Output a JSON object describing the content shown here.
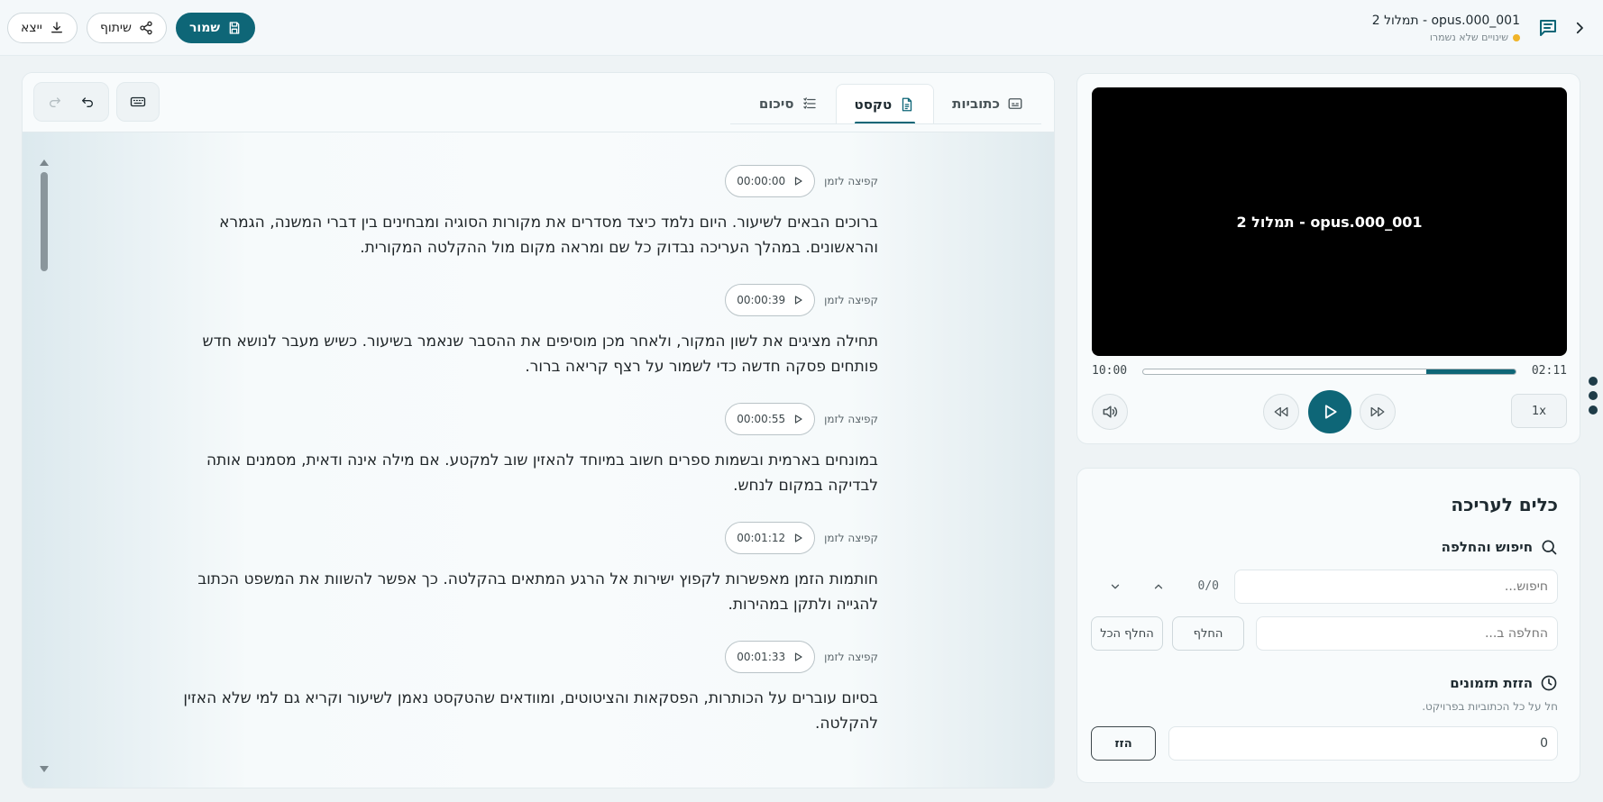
{
  "header": {
    "doc_title": "opus.000_001 - תמלול 2",
    "status": "שינויים שלא נשמרו",
    "save_label": "שמור",
    "share_label": "שיתוף",
    "export_label": "ייצא"
  },
  "editor": {
    "tabs": [
      {
        "label": "כתוביות",
        "icon": "subtitles-icon"
      },
      {
        "label": "טקסט",
        "icon": "document-icon"
      },
      {
        "label": "סיכום",
        "icon": "list-icon"
      }
    ],
    "jump_label": "קפיצה לזמן",
    "paragraphs": [
      {
        "time": "00:00:00",
        "text": "ברוכים הבאים לשיעור. היום נלמד כיצד מסדרים את מקורות הסוגיה ומבחינים בין דברי המשנה, הגמרא והראשונים. במהלך העריכה נבדוק כל שם ומראה מקום מול ההקלטה המקורית."
      },
      {
        "time": "00:00:39",
        "text": "תחילה מציגים את לשון המקור, ולאחר מכן מוסיפים את ההסבר שנאמר בשיעור. כשיש מעבר לנושא חדש פותחים פסקה חדשה כדי לשמור על רצף קריאה ברור."
      },
      {
        "time": "00:00:55",
        "text": "במונחים בארמית ובשמות ספרים חשוב במיוחד להאזין שוב למקטע. אם מילה אינה ודאית, מסמנים אותה לבדיקה במקום לנחש."
      },
      {
        "time": "00:01:12",
        "text": "חותמות הזמן מאפשרות לקפוץ ישירות אל הרגע המתאים בהקלטה. כך אפשר להשוות את המשפט הכתוב להגייה ולתקן במהירות."
      },
      {
        "time": "00:01:33",
        "text": "בסיום עוברים על הכותרות, הפסקאות והציטוטים, ומוודאים שהטקסט נאמן לשיעור וקריא גם למי שלא האזין להקלטה."
      }
    ]
  },
  "player": {
    "video_title": "opus.000_001 - תמלול 2",
    "current_time": "10:00",
    "duration": "02:11",
    "progress": 0.24,
    "speed": "1x"
  },
  "tools": {
    "title": "כלים לעריכה",
    "search_title": "חיפוש והחלפה",
    "search_placeholder": "חיפוש...",
    "match_count": "0/0",
    "replace_placeholder": "החלפה ב...",
    "replace_label": "החלף",
    "replace_all_label": "החלף הכל",
    "shift_title": "הזזת תזמונים",
    "shift_hint": "חל על כל הכתוביות בפרויקט.",
    "shift_value": "0",
    "shift_button": "הזז"
  },
  "colors": {
    "accent": "#0e6677",
    "background": "#eef3f5",
    "unsaved_dot": "#f0b429"
  }
}
